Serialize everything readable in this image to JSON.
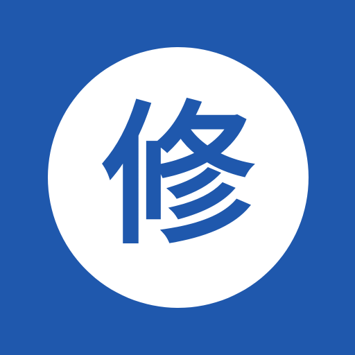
{
  "icon": {
    "character": "修",
    "background_color": "#1f58ad",
    "badge_color": "#ffffff",
    "glyph_color": "#1f58ad",
    "shape": "circle"
  }
}
